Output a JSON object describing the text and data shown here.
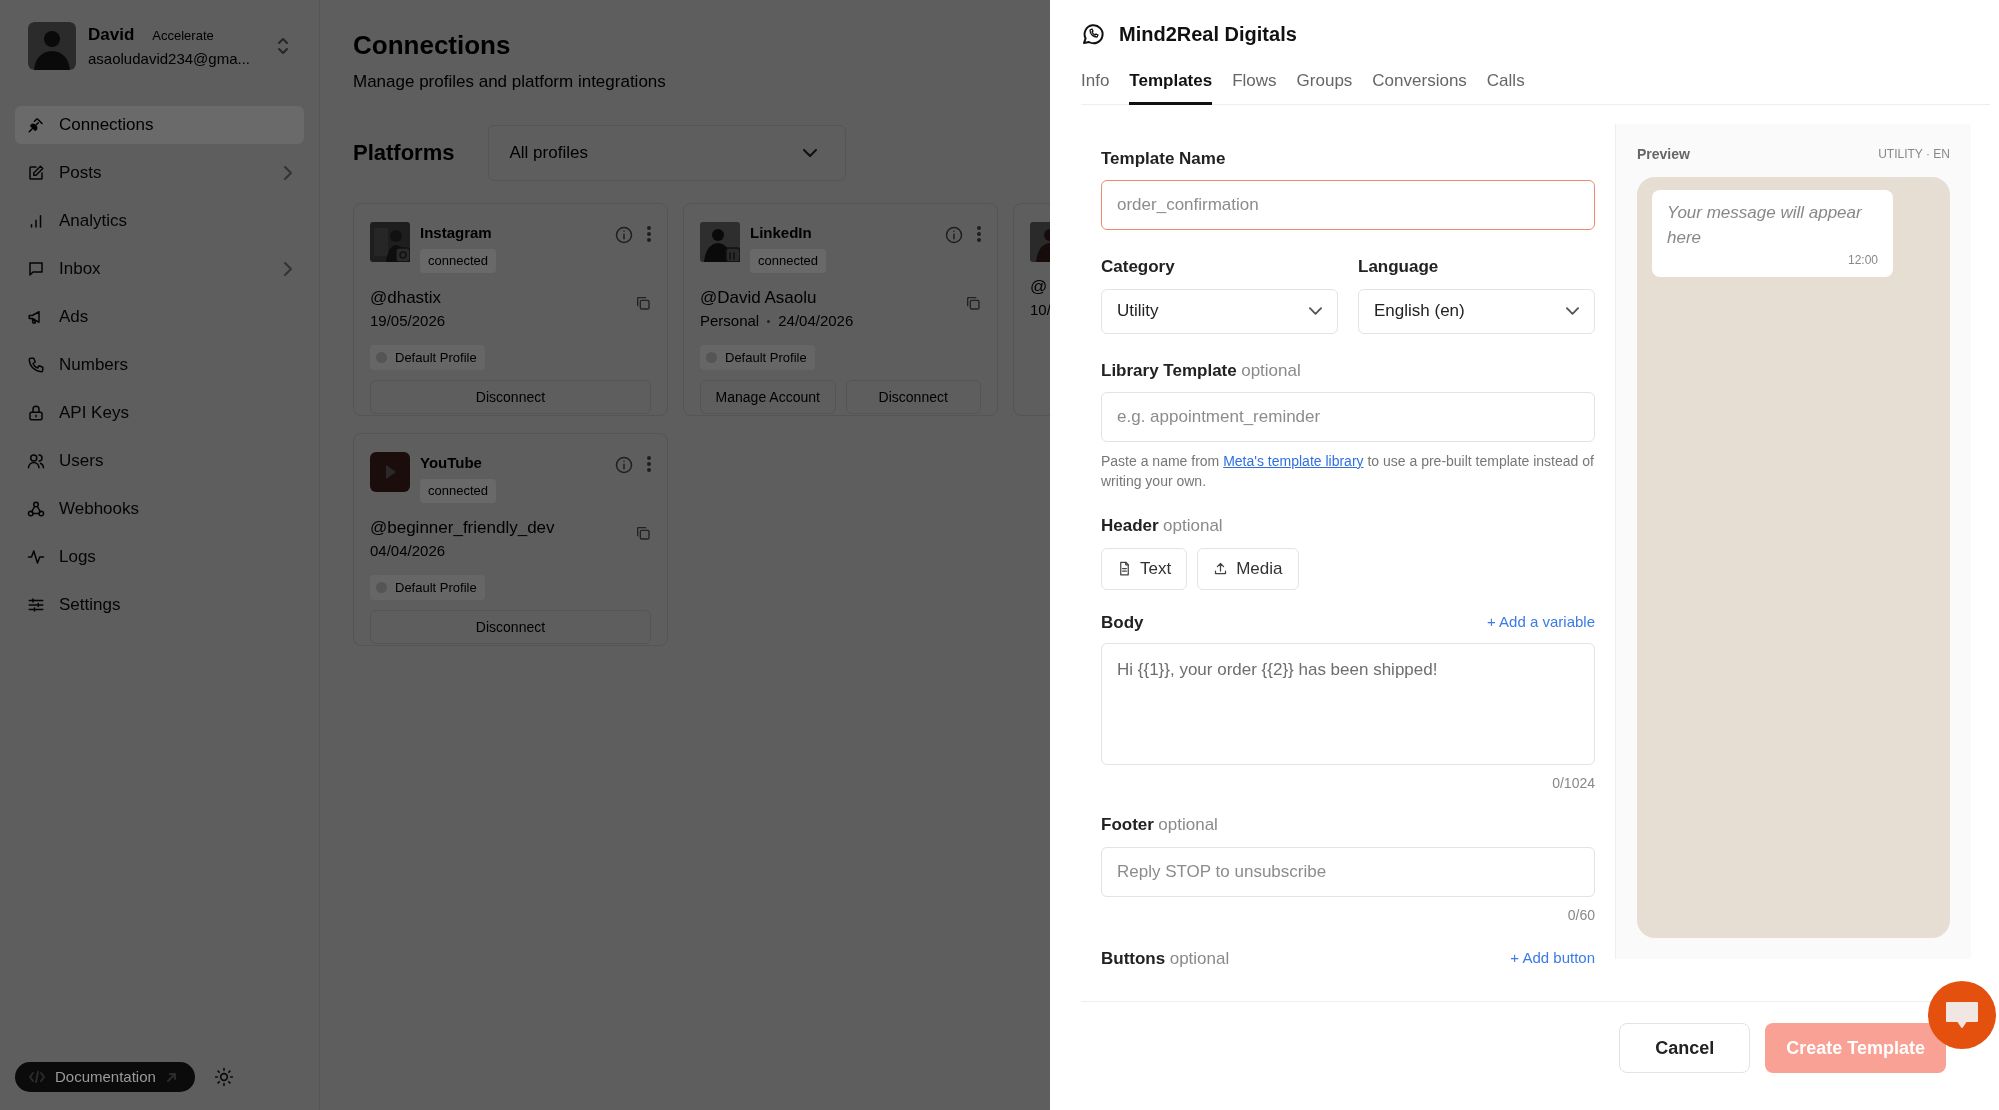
{
  "sidebar": {
    "user": {
      "name": "David",
      "plan": "Accelerate",
      "email": "asaoludavid234@gma..."
    },
    "nav": [
      {
        "label": "Connections",
        "selected": true,
        "has_submenu": false
      },
      {
        "label": "Posts",
        "selected": false,
        "has_submenu": true
      },
      {
        "label": "Analytics",
        "selected": false,
        "has_submenu": false
      },
      {
        "label": "Inbox",
        "selected": false,
        "has_submenu": true
      },
      {
        "label": "Ads",
        "selected": false,
        "has_submenu": false
      },
      {
        "label": "Numbers",
        "selected": false,
        "has_submenu": false
      },
      {
        "label": "API Keys",
        "selected": false,
        "has_submenu": false
      },
      {
        "label": "Users",
        "selected": false,
        "has_submenu": false
      },
      {
        "label": "Webhooks",
        "selected": false,
        "has_submenu": false
      },
      {
        "label": "Logs",
        "selected": false,
        "has_submenu": false
      },
      {
        "label": "Settings",
        "selected": false,
        "has_submenu": false
      }
    ],
    "documentation": "Documentation"
  },
  "main": {
    "title": "Connections",
    "subtitle": "Manage profiles and platform integrations",
    "platforms_title": "Platforms",
    "filter": "All profiles",
    "cards": [
      {
        "platform": "Instagram",
        "status": "connected",
        "handle": "@dhastix",
        "meta": [
          "19/05/2026"
        ],
        "profile": "Default Profile",
        "actions": [
          "Disconnect"
        ]
      },
      {
        "platform": "LinkedIn",
        "status": "connected",
        "handle": "@David Asaolu",
        "meta": [
          "Personal",
          "24/04/2026"
        ],
        "profile": "Default Profile",
        "actions": [
          "Manage Account",
          "Disconnect"
        ]
      },
      {
        "handle": "@",
        "meta": [
          "10/"
        ]
      },
      {
        "platform": "YouTube",
        "status": "connected",
        "handle": "@beginner_friendly_dev",
        "meta": [
          "04/04/2026"
        ],
        "profile": "Default Profile",
        "actions": [
          "Disconnect"
        ]
      }
    ]
  },
  "drawer": {
    "title": "Mind2Real Digitals",
    "tabs": [
      {
        "label": "Info",
        "selected": false
      },
      {
        "label": "Templates",
        "selected": true
      },
      {
        "label": "Flows",
        "selected": false
      },
      {
        "label": "Groups",
        "selected": false
      },
      {
        "label": "Conversions",
        "selected": false
      },
      {
        "label": "Calls",
        "selected": false
      }
    ],
    "template_name": {
      "label": "Template Name",
      "placeholder": "order_confirmation",
      "focused": true
    },
    "category": {
      "label": "Category",
      "value": "Utility"
    },
    "language": {
      "label": "Language",
      "value": "English (en)"
    },
    "library_template": {
      "label": "Library Template",
      "optional": "optional",
      "placeholder": "e.g. appointment_reminder",
      "help_before": "Paste a name from ",
      "help_link": "Meta's template library",
      "help_after": " to use a pre-built template instead of writing your own."
    },
    "header": {
      "label": "Header",
      "optional": "optional",
      "options": [
        "Text",
        "Media"
      ]
    },
    "body": {
      "label": "Body",
      "action": "+ Add a variable",
      "placeholder": "Hi {{1}}, your order {{2}} has been shipped!",
      "counter": "0/1024"
    },
    "footer": {
      "label": "Footer",
      "optional": "optional",
      "placeholder": "Reply STOP to unsubscribe",
      "counter": "0/60"
    },
    "buttons": {
      "label": "Buttons",
      "optional": "optional",
      "action": "+ Add button"
    },
    "preview": {
      "title": "Preview",
      "tag": "UTILITY · EN",
      "message": "Your message will appear here",
      "time": "12:00"
    },
    "cancel": "Cancel",
    "create": {
      "label": "Create Template",
      "disabled": true
    }
  }
}
